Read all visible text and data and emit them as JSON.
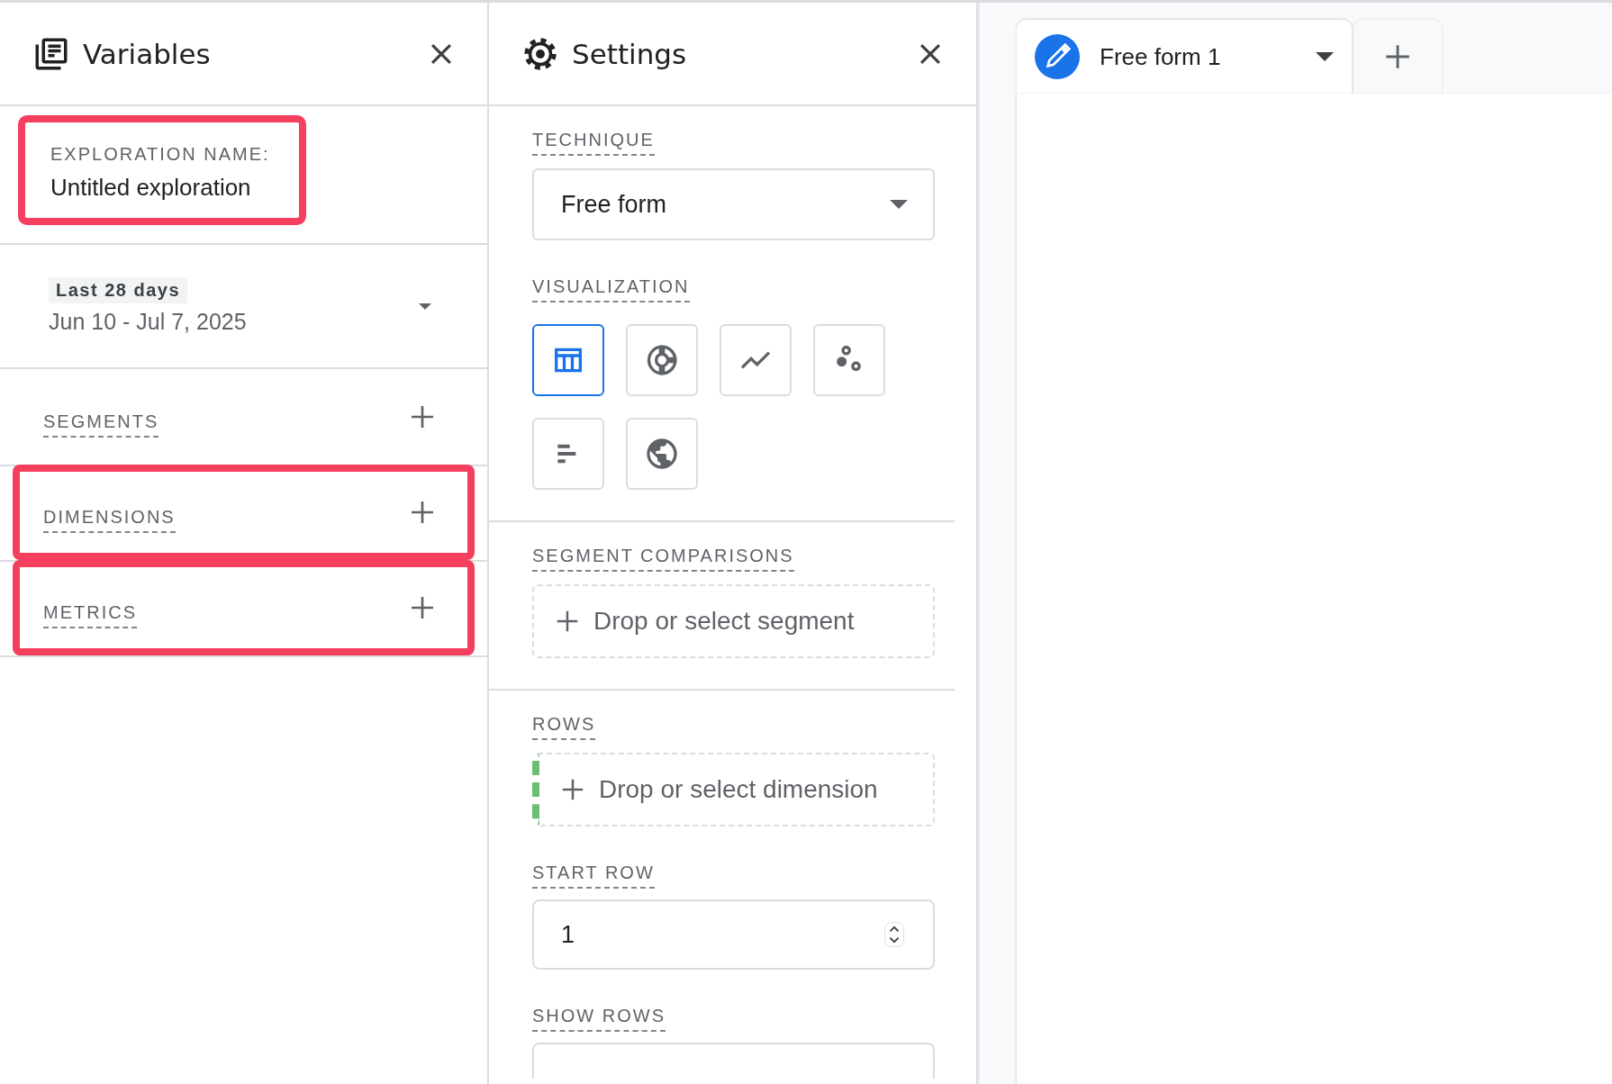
{
  "variables_panel": {
    "title": "Variables",
    "exploration_name": {
      "label": "EXPLORATION NAME:",
      "value": "Untitled exploration",
      "highlighted": true
    },
    "date_range": {
      "preset": "Last 28 days",
      "range": "Jun 10 - Jul 7, 2025"
    },
    "sections": [
      {
        "label": "SEGMENTS",
        "highlighted": false
      },
      {
        "label": "DIMENSIONS",
        "highlighted": true
      },
      {
        "label": "METRICS",
        "highlighted": true
      }
    ]
  },
  "settings_panel": {
    "title": "Settings",
    "technique": {
      "label": "TECHNIQUE",
      "value": "Free form"
    },
    "visualization": {
      "label": "VISUALIZATION",
      "options": [
        {
          "kind": "table",
          "selected": true
        },
        {
          "kind": "donut",
          "selected": false
        },
        {
          "kind": "line",
          "selected": false
        },
        {
          "kind": "scatter",
          "selected": false
        },
        {
          "kind": "bar",
          "selected": false
        },
        {
          "kind": "geo",
          "selected": false
        }
      ]
    },
    "segment_comparisons": {
      "label": "SEGMENT COMPARISONS",
      "placeholder": "Drop or select segment"
    },
    "rows": {
      "label": "ROWS",
      "placeholder": "Drop or select dimension"
    },
    "start_row": {
      "label": "START ROW",
      "value": "1"
    },
    "show_rows": {
      "label": "SHOW ROWS"
    }
  },
  "canvas": {
    "tabs": [
      {
        "label": "Free form 1",
        "selected": true
      }
    ]
  }
}
